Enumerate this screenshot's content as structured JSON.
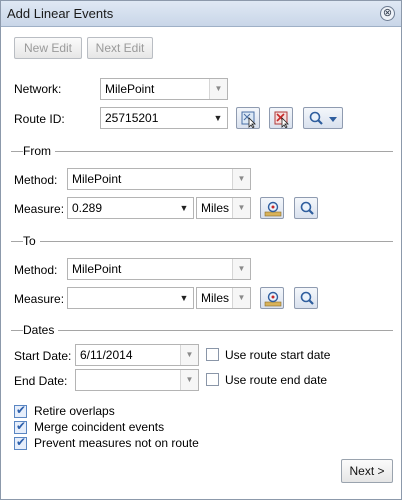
{
  "window": {
    "title": "Add Linear Events",
    "close_icon": "⊗"
  },
  "toolbar": {
    "new_edit": "New Edit",
    "next_edit": "Next Edit"
  },
  "network": {
    "label": "Network:",
    "value": "MilePoint"
  },
  "route": {
    "label": "Route ID:",
    "value": "25715201"
  },
  "from": {
    "section_title": "From",
    "method_label": "Method:",
    "method_value": "MilePoint",
    "measure_label": "Measure:",
    "measure_value": "0.289",
    "units_value": "Miles"
  },
  "to": {
    "section_title": "To",
    "method_label": "Method:",
    "method_value": "MilePoint",
    "measure_label": "Measure:",
    "measure_value": "",
    "units_value": "Miles"
  },
  "dates": {
    "section_title": "Dates",
    "start_label": "Start Date:",
    "start_value": "6/11/2014",
    "use_start_label": "Use route start date",
    "end_label": "End Date:",
    "end_value": "",
    "use_end_label": "Use route end date"
  },
  "options": [
    {
      "label": "Retire overlaps",
      "checked": true
    },
    {
      "label": "Merge coincident events",
      "checked": true
    },
    {
      "label": "Prevent measures not on route",
      "checked": true
    }
  ],
  "footer": {
    "next_label": "Next >"
  },
  "colors": {
    "titlebar": "#c9d6e8",
    "accent": "#2c5fab"
  }
}
